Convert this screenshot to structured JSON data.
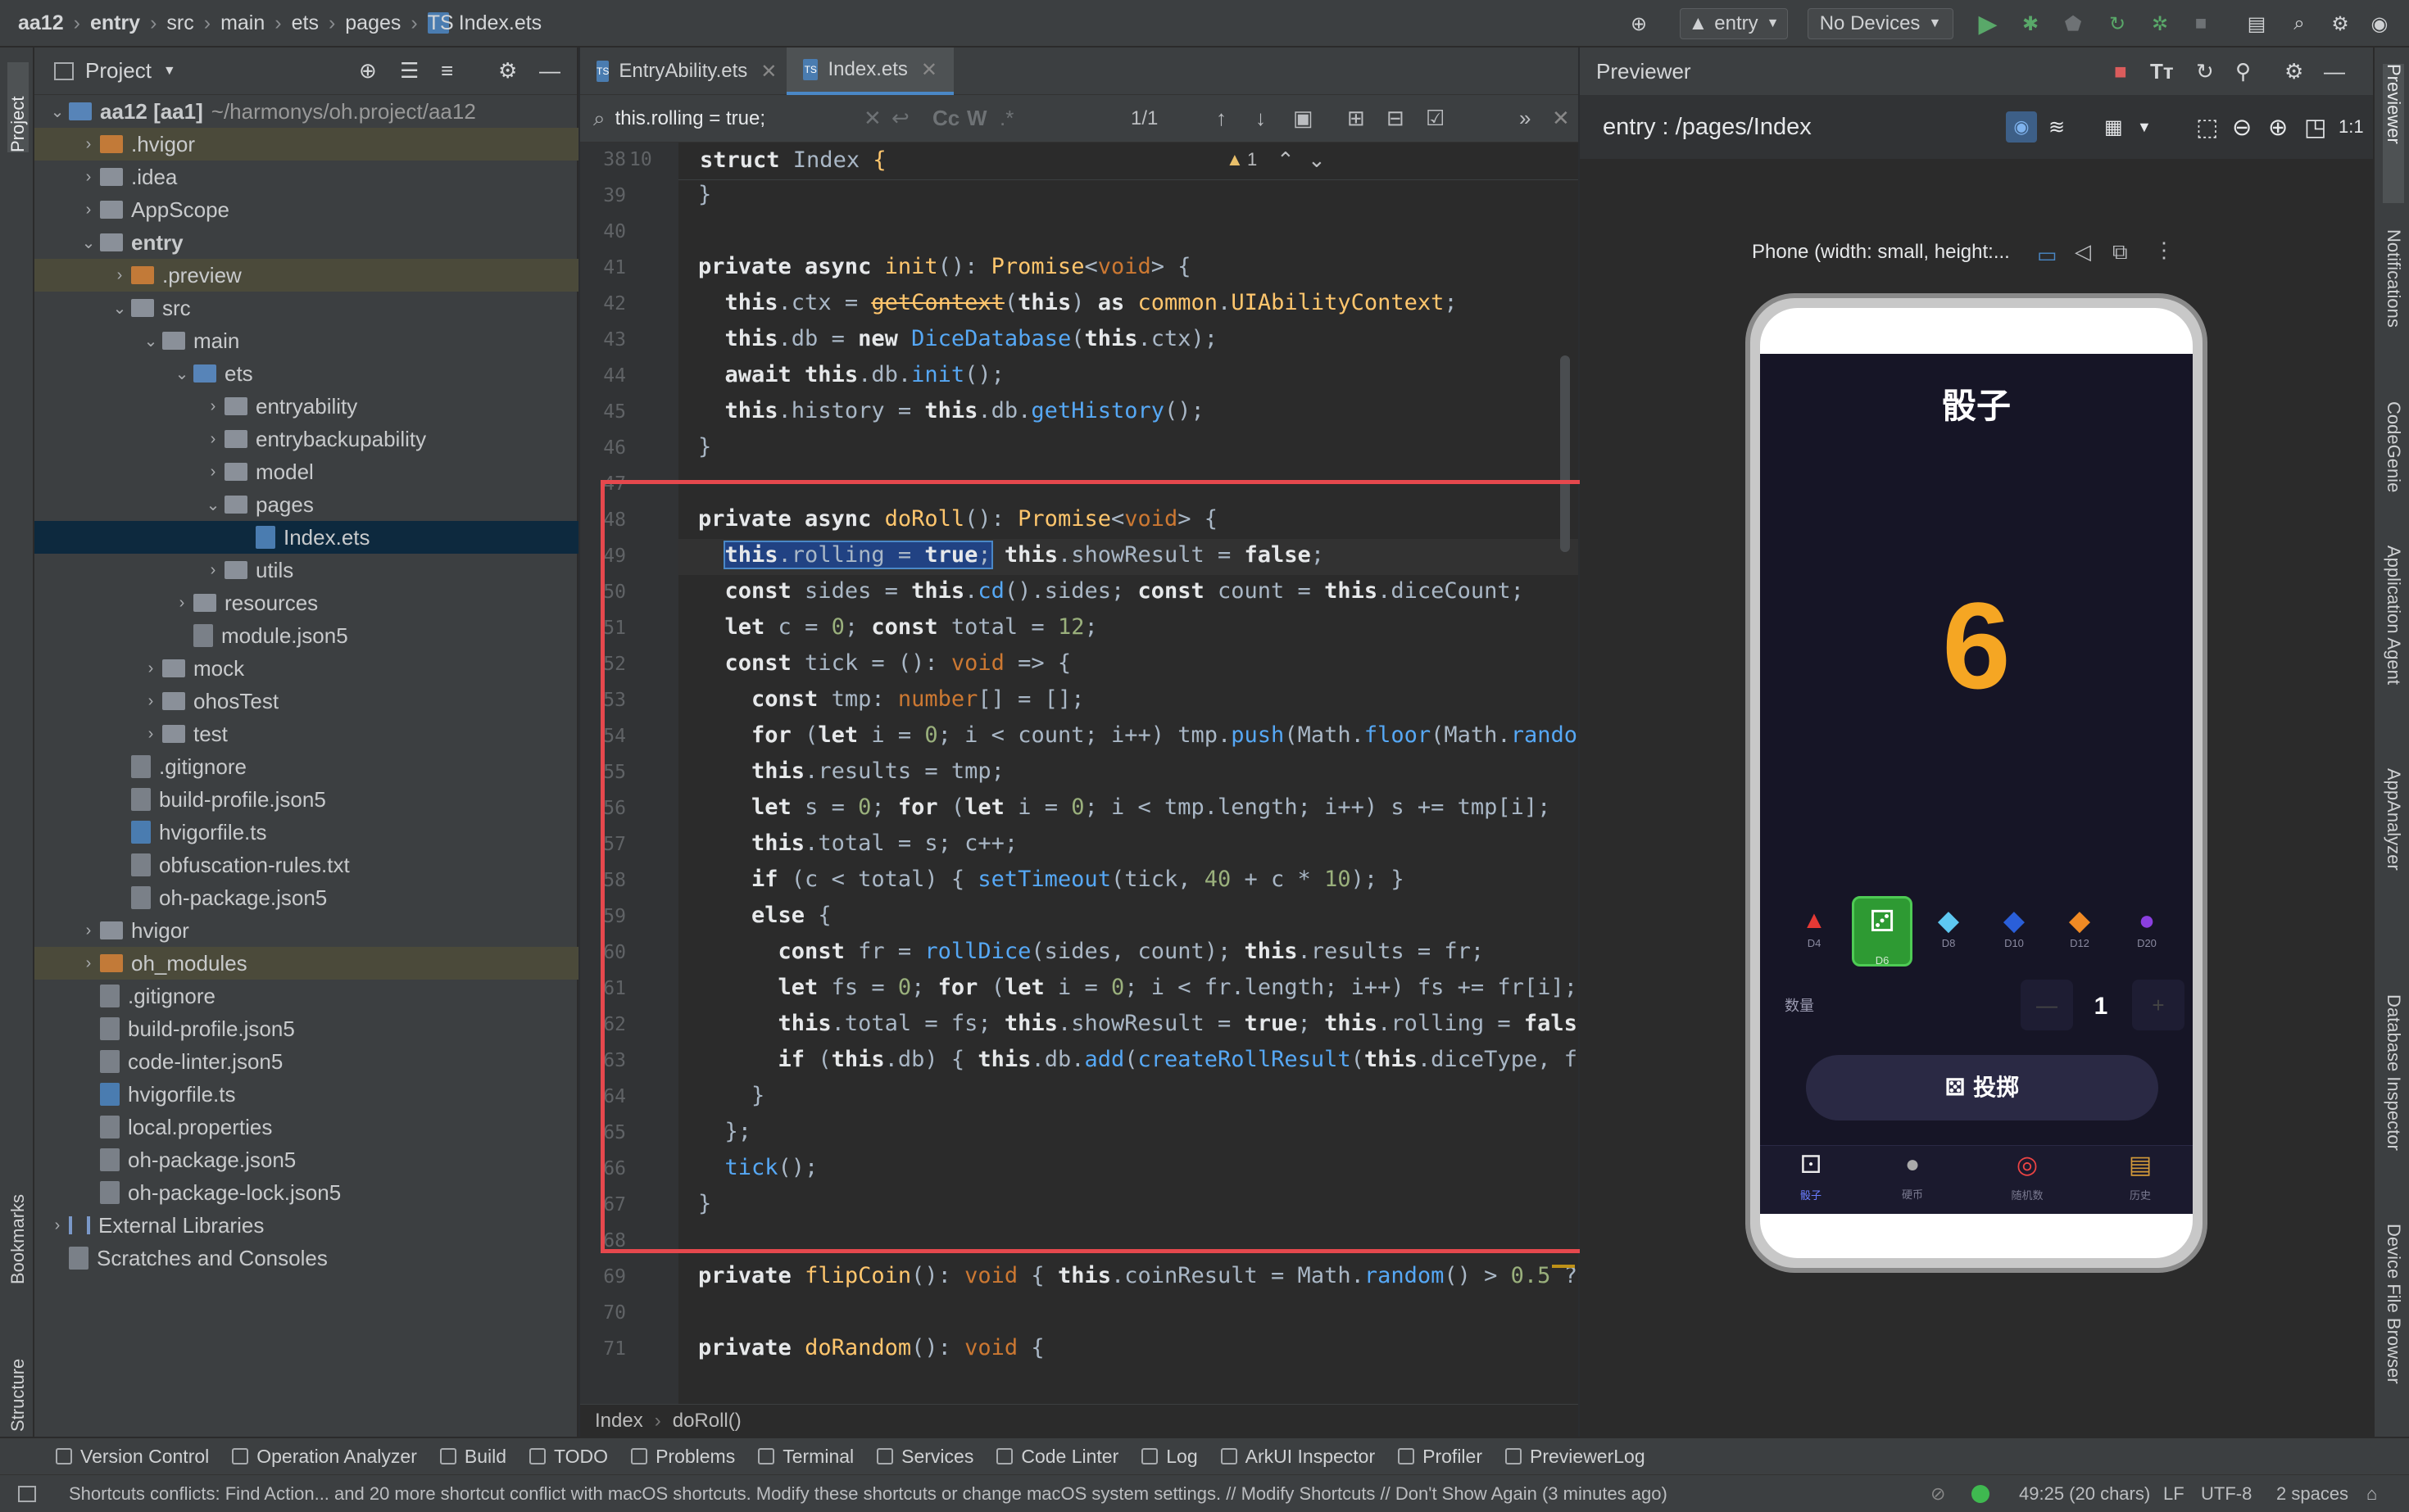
{
  "breadcrumb": [
    "aa12",
    "entry",
    "src",
    "main",
    "ets",
    "pages",
    "Index.ets"
  ],
  "toolbar": {
    "run_config": "entry",
    "device": "No Devices"
  },
  "project": {
    "title": "Project",
    "root_label": "aa12 [aa1]",
    "root_path": "~/harmonys/oh.project/aa12",
    "items": [
      {
        "label": "aa12 [aa1]",
        "depth": 0,
        "type": "folder-blue",
        "open": true
      },
      {
        "label": ".hvigor",
        "depth": 1,
        "type": "folder-orange"
      },
      {
        "label": ".idea",
        "depth": 1,
        "type": "folder"
      },
      {
        "label": "AppScope",
        "depth": 1,
        "type": "folder"
      },
      {
        "label": "entry",
        "depth": 1,
        "type": "folder",
        "open": true
      },
      {
        "label": ".preview",
        "depth": 2,
        "type": "folder-orange"
      },
      {
        "label": "src",
        "depth": 2,
        "type": "folder",
        "open": true
      },
      {
        "label": "main",
        "depth": 3,
        "type": "folder",
        "open": true
      },
      {
        "label": "ets",
        "depth": 4,
        "type": "folder-blue",
        "open": true
      },
      {
        "label": "entryability",
        "depth": 5,
        "type": "folder"
      },
      {
        "label": "entrybackupability",
        "depth": 5,
        "type": "folder"
      },
      {
        "label": "model",
        "depth": 5,
        "type": "folder"
      },
      {
        "label": "pages",
        "depth": 5,
        "type": "folder",
        "open": true
      },
      {
        "label": "Index.ets",
        "depth": 6,
        "type": "file-ts"
      },
      {
        "label": "utils",
        "depth": 5,
        "type": "folder"
      },
      {
        "label": "resources",
        "depth": 4,
        "type": "folder"
      },
      {
        "label": "module.json5",
        "depth": 4,
        "type": "file"
      },
      {
        "label": "mock",
        "depth": 3,
        "type": "folder"
      },
      {
        "label": "ohosTest",
        "depth": 3,
        "type": "folder"
      },
      {
        "label": "test",
        "depth": 3,
        "type": "folder"
      },
      {
        "label": ".gitignore",
        "depth": 2,
        "type": "file"
      },
      {
        "label": "build-profile.json5",
        "depth": 2,
        "type": "file"
      },
      {
        "label": "hvigorfile.ts",
        "depth": 2,
        "type": "file-ts"
      },
      {
        "label": "obfuscation-rules.txt",
        "depth": 2,
        "type": "file"
      },
      {
        "label": "oh-package.json5",
        "depth": 2,
        "type": "file"
      },
      {
        "label": "hvigor",
        "depth": 1,
        "type": "folder"
      },
      {
        "label": "oh_modules",
        "depth": 1,
        "type": "folder-orange"
      },
      {
        "label": ".gitignore",
        "depth": 1,
        "type": "file"
      },
      {
        "label": "build-profile.json5",
        "depth": 1,
        "type": "file"
      },
      {
        "label": "code-linter.json5",
        "depth": 1,
        "type": "file"
      },
      {
        "label": "hvigorfile.ts",
        "depth": 1,
        "type": "file-ts"
      },
      {
        "label": "local.properties",
        "depth": 1,
        "type": "file"
      },
      {
        "label": "oh-package.json5",
        "depth": 1,
        "type": "file"
      },
      {
        "label": "oh-package-lock.json5",
        "depth": 1,
        "type": "file"
      },
      {
        "label": "External Libraries",
        "depth": 0,
        "type": "lib"
      },
      {
        "label": "Scratches and Consoles",
        "depth": 0,
        "type": "scratch"
      }
    ]
  },
  "editor": {
    "tabs": [
      "EntryAbility.ets",
      "Index.ets"
    ],
    "find_query": "this.rolling = true;",
    "find_count": "1/1",
    "sticky_line_number": "10",
    "sticky_code": "struct Index {",
    "warnings": "1",
    "breadcrumb": [
      "Index",
      "doRoll()"
    ]
  },
  "previewer": {
    "title": "Previewer",
    "route": "entry : /pages/Index",
    "device_label": "Phone (width: small, height:...",
    "app": {
      "title": "骰子",
      "result": "6",
      "dice": [
        "D4",
        "D6",
        "D8",
        "D10",
        "D12",
        "D20"
      ],
      "quantity_label": "数量",
      "quantity": "1",
      "roll_button": "投掷",
      "tabs": [
        "骰子",
        "硬币",
        "随机数",
        "历史"
      ]
    }
  },
  "side_tools_left": [
    "Project",
    "Bookmarks",
    "Structure"
  ],
  "side_tools_right": [
    "Previewer",
    "Notifications",
    "CodeGenie",
    "Application Agent",
    "AppAnalyzer",
    "Database Inspector",
    "Device File Browser"
  ],
  "tool_windows": [
    "Version Control",
    "Operation Analyzer",
    "Build",
    "TODO",
    "Problems",
    "Terminal",
    "Services",
    "Code Linter",
    "Log",
    "ArkUI Inspector",
    "Profiler",
    "PreviewerLog"
  ],
  "status": {
    "message": "Shortcuts conflicts: Find Action... and 20 more shortcut conflict with macOS shortcuts. Modify these shortcuts or change macOS system settings. // Modify Shortcuts // Don't Show Again (3 minutes ago)",
    "position": "49:25 (20 chars)",
    "line_sep": "LF",
    "encoding": "UTF-8",
    "indent": "2 spaces"
  }
}
